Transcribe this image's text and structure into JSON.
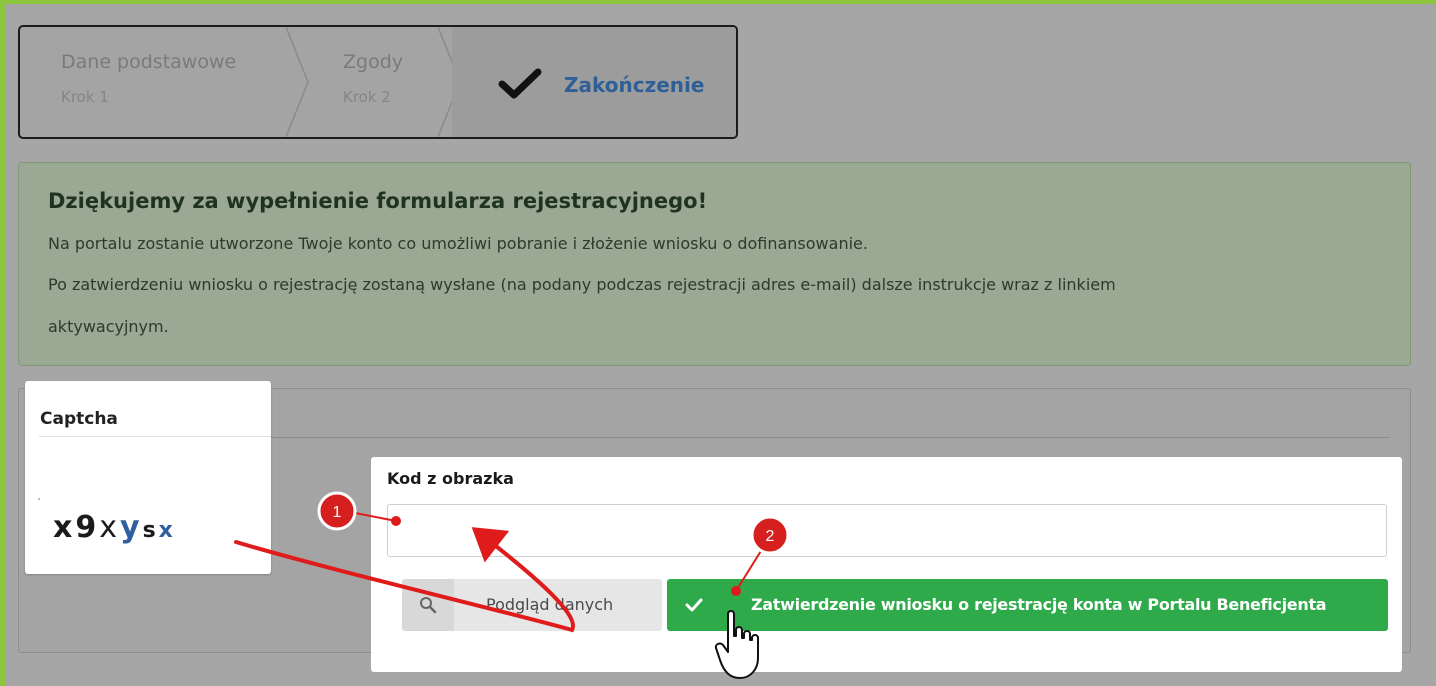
{
  "steps": [
    {
      "title": "Dane podstawowe",
      "subtitle": "Krok 1",
      "state": "completed"
    },
    {
      "title": "Zgody",
      "subtitle": "Krok 2",
      "state": "completed"
    },
    {
      "title": "Zakończenie",
      "state": "current",
      "icon": "check-icon"
    }
  ],
  "success": {
    "heading": "Dziękujemy za wypełnienie formularza rejestracyjnego!",
    "line1": "Na portalu zostanie utworzone Twoje konto co umożliwi pobranie i złożenie wniosku o dofinansowanie.",
    "line2": "Po zatwierdzeniu wniosku o rejestrację zostaną wysłane (na podany podczas rejestracji adres e-mail) dalsze instrukcje wraz z linkiem",
    "line3": "aktywacyjnym."
  },
  "captcha": {
    "label": "Captcha",
    "chars": [
      "x",
      "9",
      "x",
      "y",
      "s",
      "x"
    ]
  },
  "form": {
    "code_label": "Kod z obrazka",
    "code_value": "",
    "preview_button": {
      "label": "Podgląd danych",
      "icon": "search-icon"
    },
    "confirm_button": {
      "label": "Zatwierdzenie wniosku o rejestrację konta w Portalu Beneficjenta",
      "icon": "check-icon"
    }
  },
  "annotations": [
    {
      "number": "1",
      "target": "code-input"
    },
    {
      "number": "2",
      "target": "confirm-button"
    }
  ],
  "colors": {
    "accent_frame": "#8cc63f",
    "current_step": "#2f5f97",
    "confirm": "#2eaa4a",
    "annotation": "#e02020"
  }
}
